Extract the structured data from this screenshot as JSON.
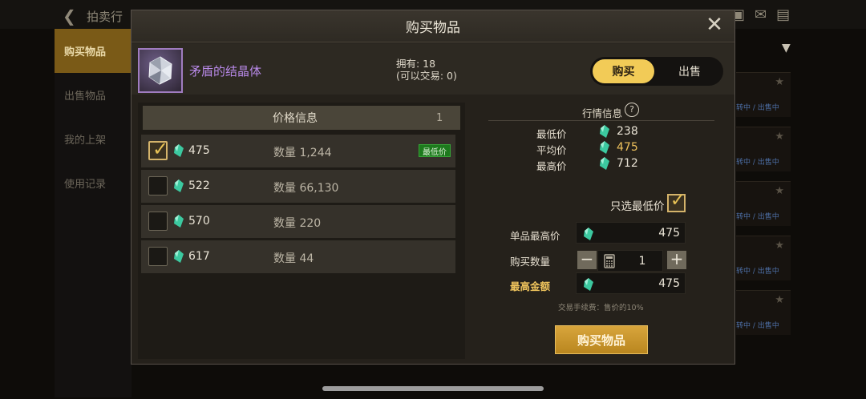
{
  "background": {
    "title": "拍卖行",
    "sidebar": [
      "购买物品",
      "出售物品",
      "我的上架",
      "使用记录"
    ],
    "right_card_text": "转中 / 出售中",
    "icons": [
      "back-arrow-icon",
      "bag-icon",
      "mail-icon",
      "chat-icon",
      "chevron-down-icon",
      "star-icon"
    ]
  },
  "modal": {
    "title": "购买物品",
    "close_icon": "close-icon",
    "item": {
      "name": "矛盾的结晶体",
      "own_label": "拥有: 18",
      "tradable_label": "(可以交易: 0)",
      "name_color": "#b889e8"
    },
    "mode_toggle": {
      "buy": "购买",
      "sell": "出售",
      "active": "购买"
    },
    "price_panel": {
      "header": "价格信息",
      "page": "1",
      "listings": [
        {
          "price": "475",
          "qty_label": "数量 1,244",
          "badge": "最低价",
          "selected": true
        },
        {
          "price": "522",
          "qty_label": "数量 66,130",
          "badge": "",
          "selected": false
        },
        {
          "price": "570",
          "qty_label": "数量 220",
          "badge": "",
          "selected": false
        },
        {
          "price": "617",
          "qty_label": "数量 44",
          "badge": "",
          "selected": false
        }
      ]
    },
    "market": {
      "title": "行情信息",
      "help_icon": "?",
      "min_label": "最低价",
      "min_value": "238",
      "avg_label": "平均价",
      "avg_value": "475",
      "max_label": "最高价",
      "max_value": "712"
    },
    "only_lowest_label": "只选最低价",
    "only_lowest_checked": true,
    "unit_max_label": "单品最高价",
    "unit_max_value": "475",
    "quantity_label": "购买数量",
    "quantity_value": "1",
    "total_max_label": "最高金额",
    "total_max_value": "475",
    "fee_note": "交易手续费：售价的10%",
    "buy_button": "购买物品",
    "colors": {
      "accent": "#f2cb57",
      "gem": "#3cc9a0",
      "lowest_badge": "#1d7a1d"
    }
  }
}
